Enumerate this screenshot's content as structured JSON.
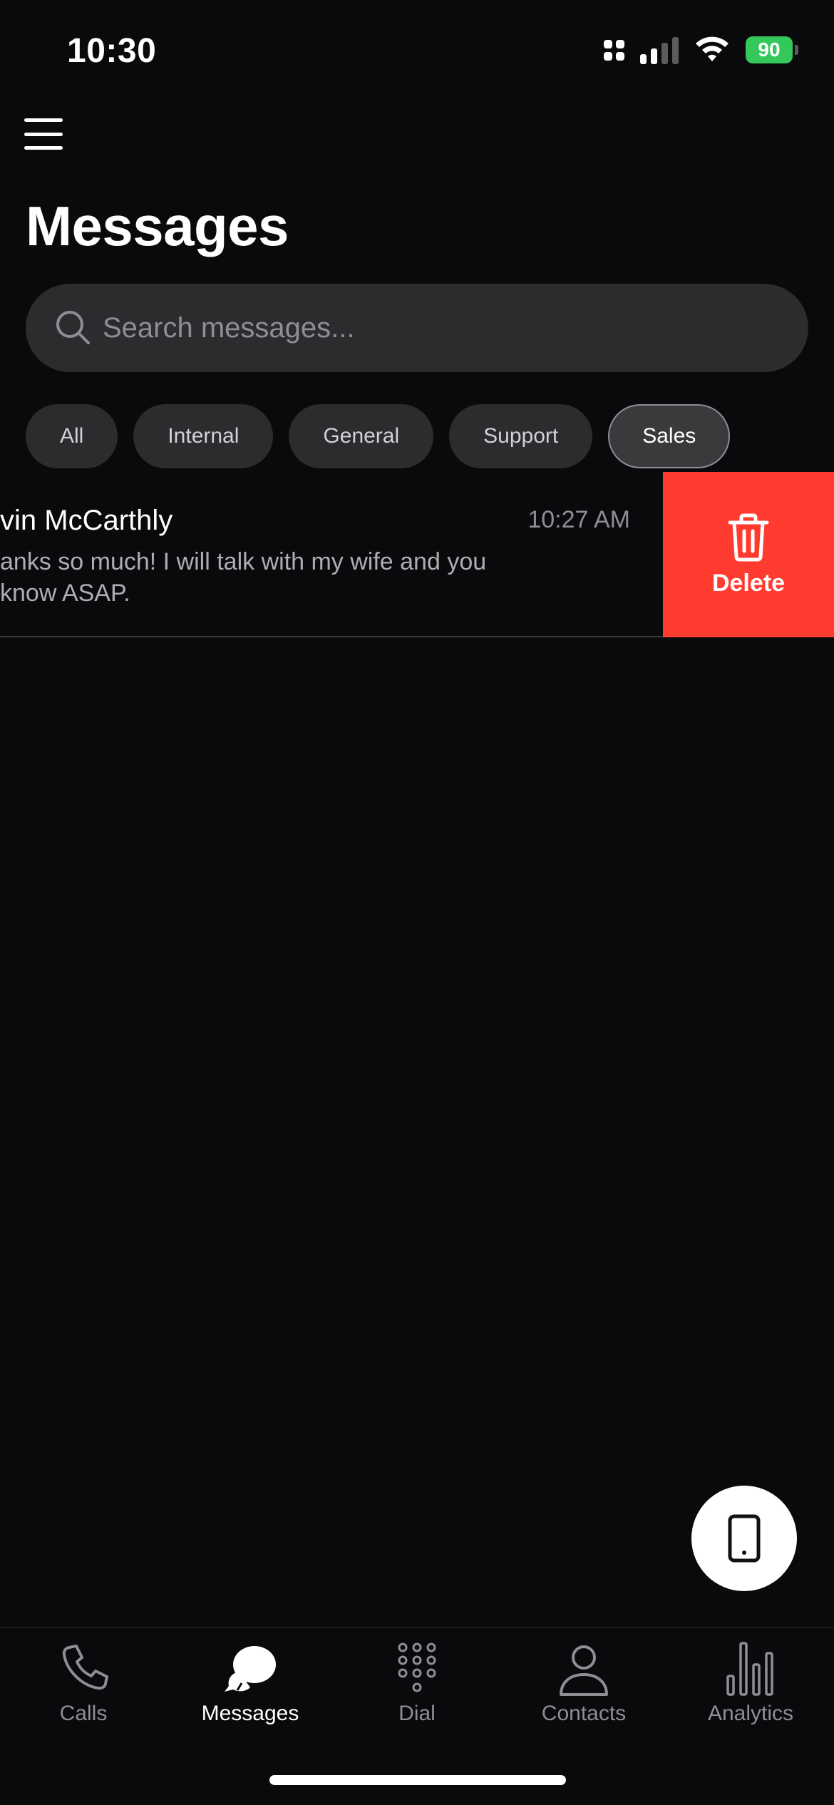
{
  "status_bar": {
    "time": "10:30",
    "battery": "90"
  },
  "header": {
    "title": "Messages"
  },
  "search": {
    "placeholder": "Search messages..."
  },
  "filters": [
    "All",
    "Internal",
    "General",
    "Support",
    "Sales"
  ],
  "active_filter": "Sales",
  "messages": [
    {
      "name": "vin McCarthly",
      "preview": "anks so much! I will talk with my wife and you know ASAP.",
      "time": "10:27 AM"
    }
  ],
  "swipe_action": {
    "delete_label": "Delete"
  },
  "tabs": [
    {
      "label": "Calls",
      "icon": "phone-icon"
    },
    {
      "label": "Messages",
      "icon": "chat-bubbles-icon"
    },
    {
      "label": "Dial",
      "icon": "dialpad-icon"
    },
    {
      "label": "Contacts",
      "icon": "person-icon"
    },
    {
      "label": "Analytics",
      "icon": "bar-chart-icon"
    }
  ],
  "active_tab": "Messages",
  "colors": {
    "background": "#0a0a0c",
    "delete": "#ff3b30",
    "battery": "#34c759",
    "chip_bg": "#2c2c2e"
  }
}
